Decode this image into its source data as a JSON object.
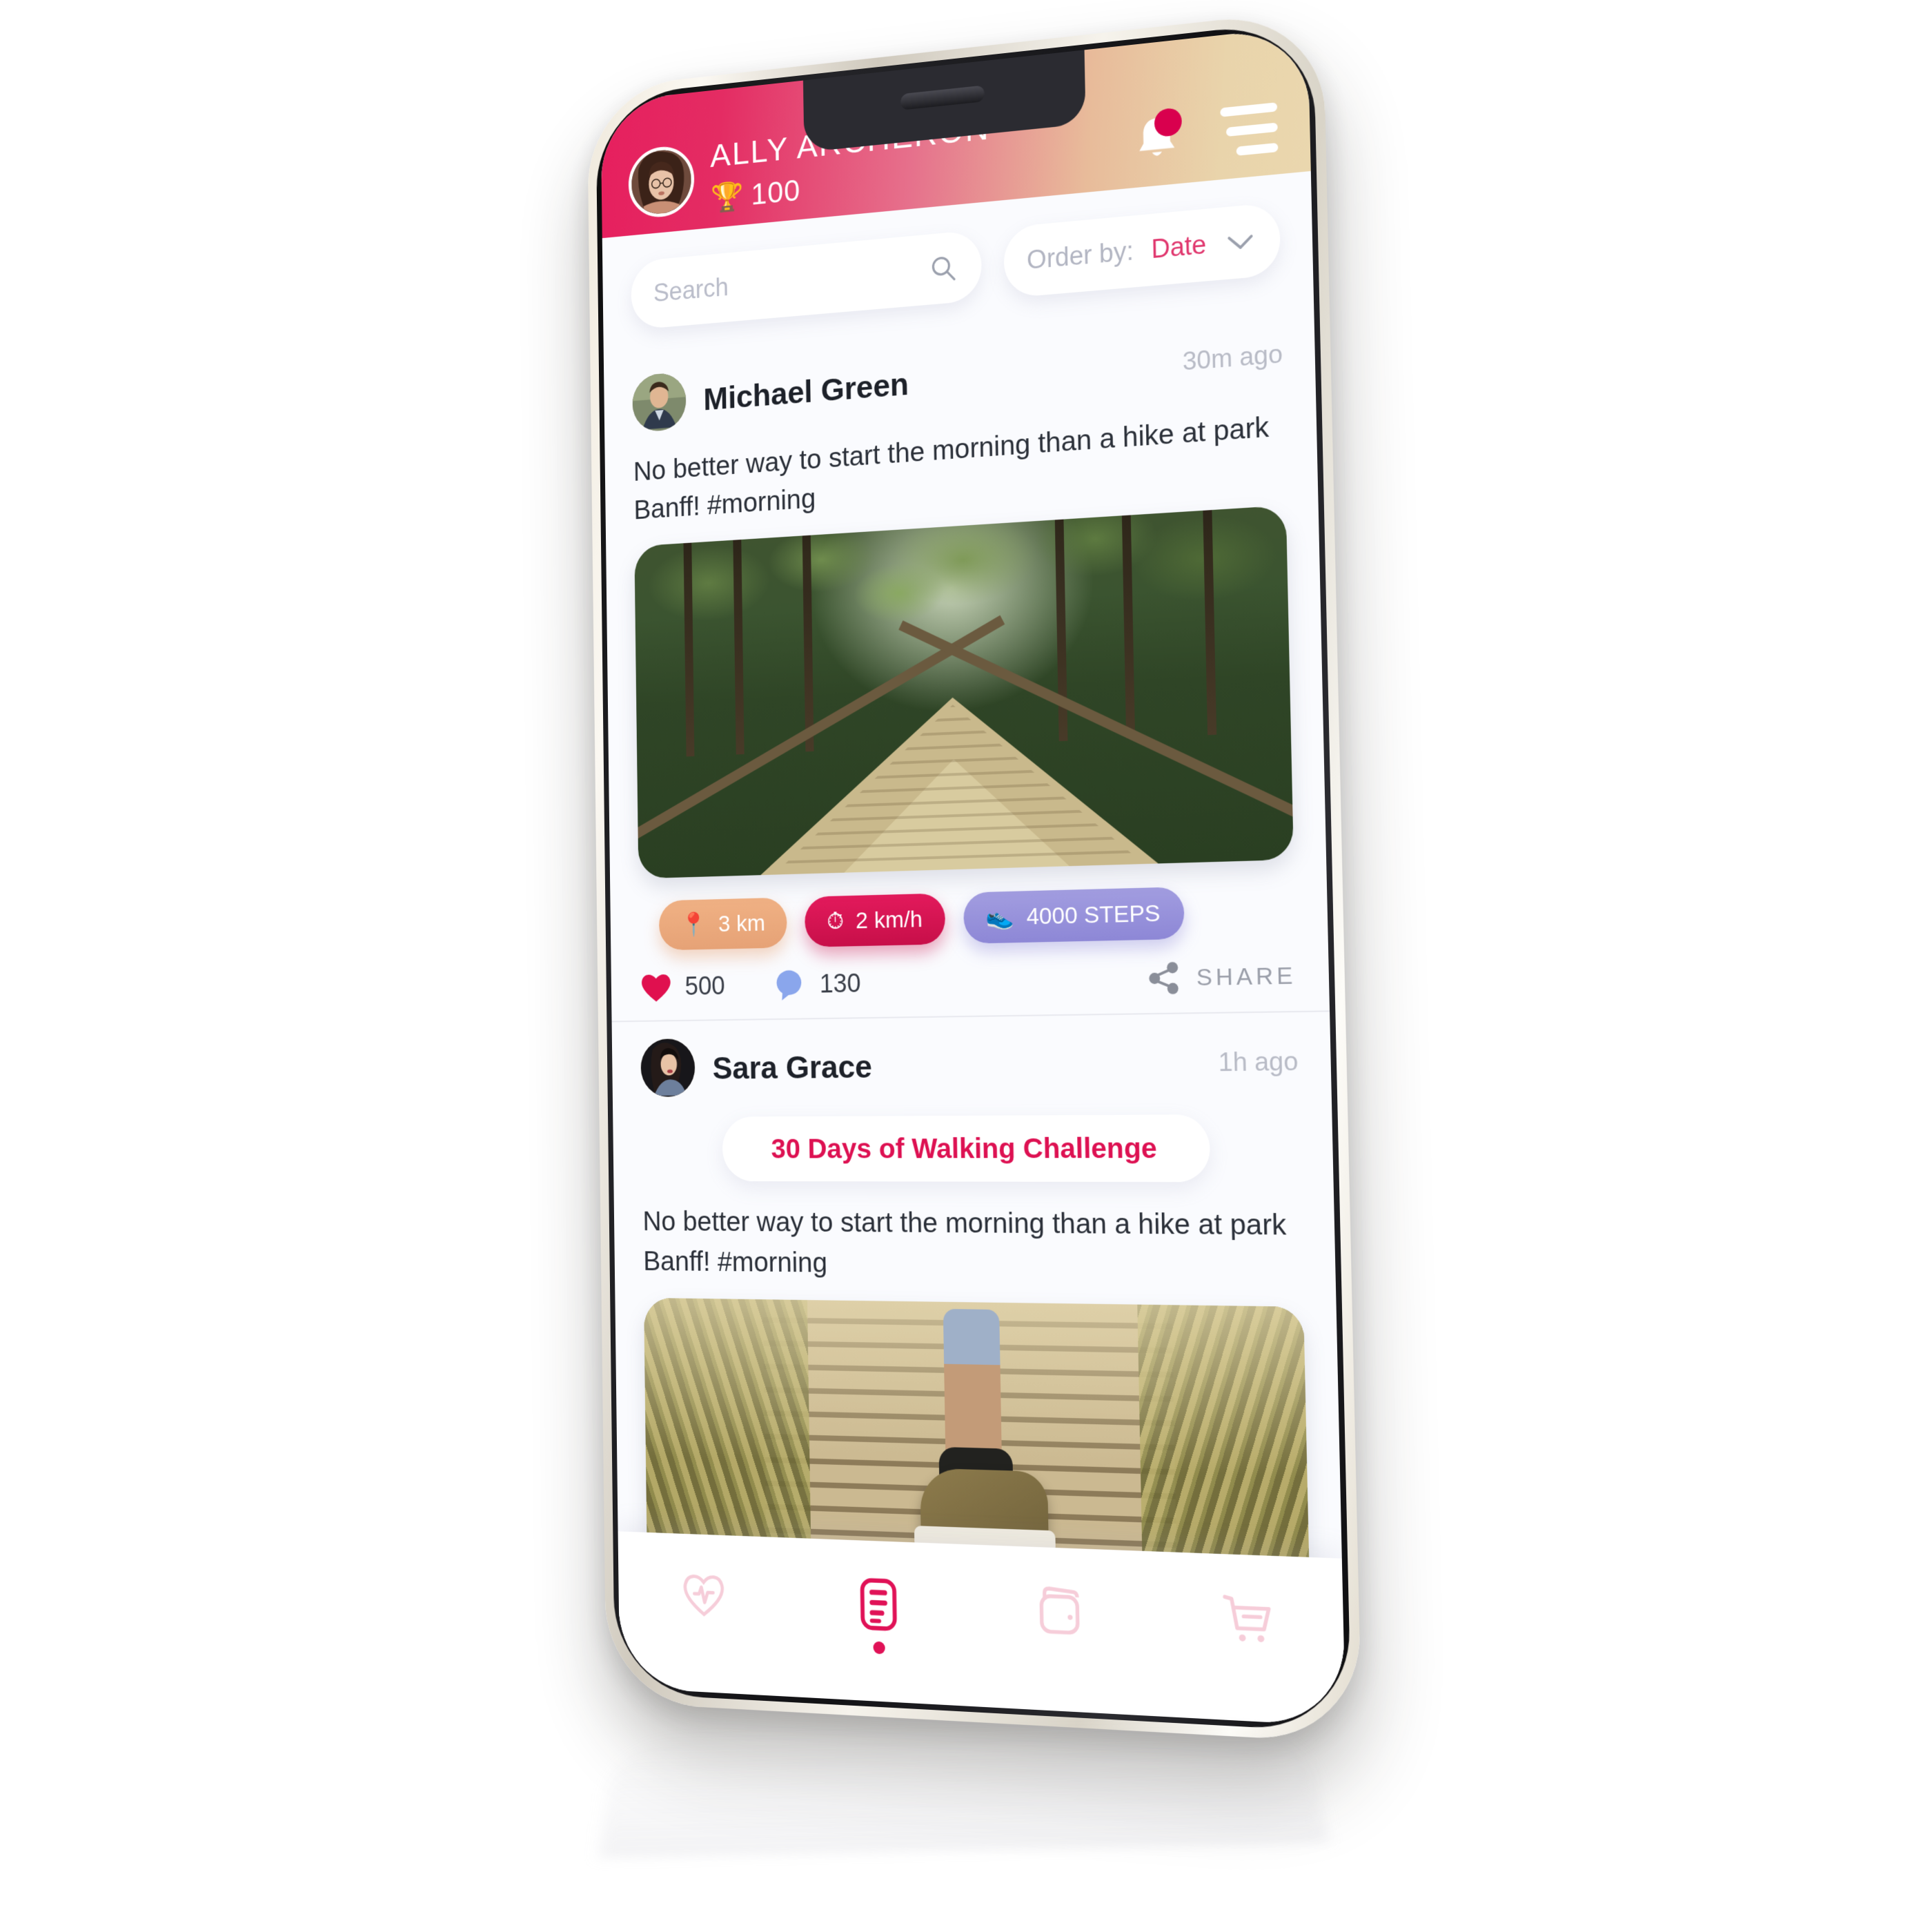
{
  "app": {
    "header": {
      "user_name": "ALLY ARCHERON",
      "trophy_icon": "trophy-icon",
      "score": "100",
      "bell_icon": "bell-icon",
      "notification_badge": "",
      "menu_icon": "hamburger-menu-icon",
      "avatar_label": "ally-archeron-avatar",
      "gradient_start": "#e61f5e",
      "gradient_end": "#ead7ae"
    },
    "toolbar": {
      "search_placeholder": "Search",
      "search_value": "",
      "search_icon": "search-icon",
      "order_by_label": "Order by:",
      "order_by_value": "Date",
      "chevron_icon": "chevron-down-icon",
      "accent_color": "#e0376e"
    },
    "feed": {
      "posts": [
        {
          "author": "Michael Green",
          "time": "30m ago",
          "avatar_label": "michael-green-avatar",
          "challenge": null,
          "text": "No better way to start the morning than a hike at park Banff! #morning",
          "image_label": "forest-boardwalk-photo",
          "stats": [
            {
              "icon": "location-pin-icon",
              "glyph": "📍",
              "value": "3 km",
              "color": "#e6a276"
            },
            {
              "icon": "speedometer-icon",
              "glyph": "⏱",
              "value": "2 km/h",
              "color": "#c70f49"
            },
            {
              "icon": "shoe-icon",
              "glyph": "👟",
              "value": "4000 STEPS",
              "color": "#8d87d6"
            }
          ],
          "likes": "500",
          "comments": "130",
          "share_label": "SHARE",
          "like_icon": "heart-icon",
          "comment_icon": "comment-bubble-icon",
          "share_icon": "share-icon"
        },
        {
          "author": "Sara Grace",
          "time": "1h ago",
          "avatar_label": "sara-grace-avatar",
          "challenge": "30 Days of Walking Challenge",
          "text": "No better way to start the morning than a hike at park Banff! #morning",
          "image_label": "walking-sneaker-photo",
          "stats": [],
          "likes": "",
          "comments": "",
          "share_label": "",
          "like_icon": "heart-icon",
          "comment_icon": "comment-bubble-icon",
          "share_icon": "share-icon"
        }
      ],
      "challenge_color": "#dd1152"
    },
    "bottom_nav": {
      "items": [
        {
          "icon": "heart-pulse-icon",
          "active": false
        },
        {
          "icon": "feed-list-icon",
          "active": true
        },
        {
          "icon": "wallet-icon",
          "active": false
        },
        {
          "icon": "shopping-cart-icon",
          "active": false
        }
      ],
      "active_color": "#e01257",
      "inactive_color": "#f6cdd9"
    }
  }
}
